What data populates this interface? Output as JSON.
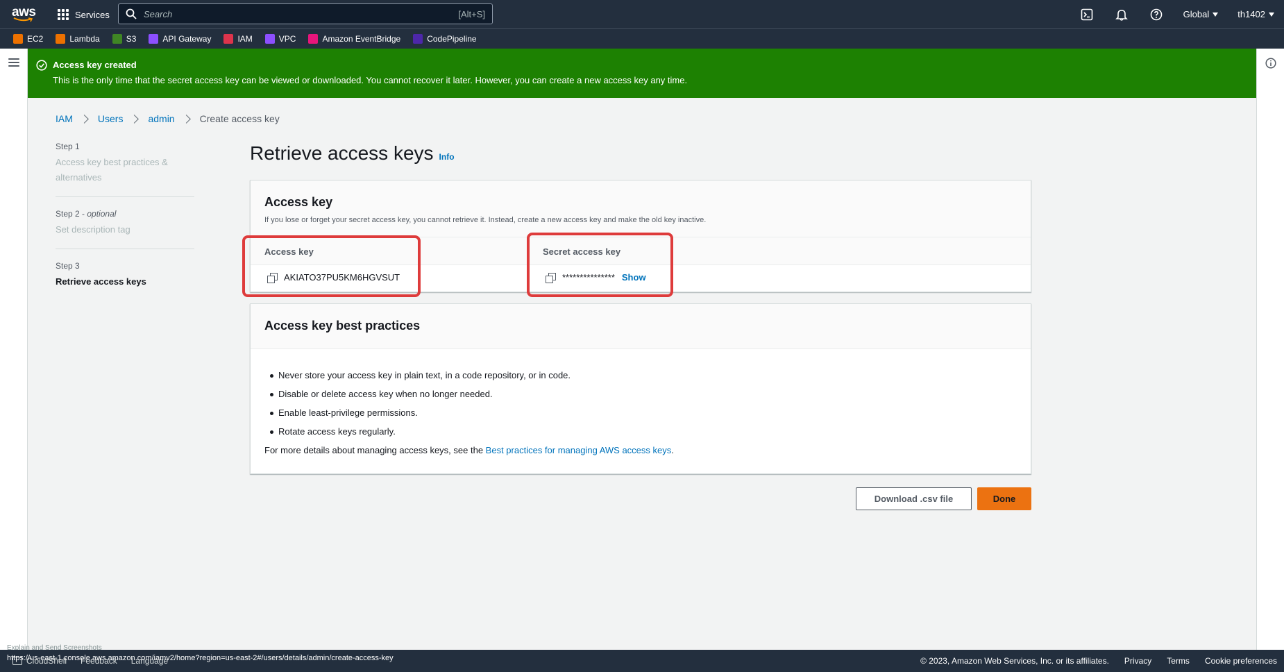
{
  "nav": {
    "logo": "aws",
    "services": "Services",
    "search_placeholder": "Search",
    "search_shortcut": "[Alt+S]",
    "region": "Global",
    "account": "th1402"
  },
  "favorites": [
    {
      "label": "EC2",
      "color": "#ed7100",
      "icon": "ec2-icon"
    },
    {
      "label": "Lambda",
      "color": "#ed7100",
      "icon": "lambda-icon"
    },
    {
      "label": "S3",
      "color": "#3f8624",
      "icon": "s3-icon"
    },
    {
      "label": "API Gateway",
      "color": "#8c4fff",
      "icon": "api-gateway-icon"
    },
    {
      "label": "IAM",
      "color": "#dd344c",
      "icon": "iam-icon"
    },
    {
      "label": "VPC",
      "color": "#8c4fff",
      "icon": "vpc-icon"
    },
    {
      "label": "Amazon EventBridge",
      "color": "#e7157b",
      "icon": "eventbridge-icon"
    },
    {
      "label": "CodePipeline",
      "color": "#4d27aa",
      "icon": "codepipeline-icon"
    }
  ],
  "flash": {
    "title": "Access key created",
    "message": "This is the only time that the secret access key can be viewed or downloaded. You cannot recover it later. However, you can create a new access key any time.",
    "color": "#1d8102"
  },
  "breadcrumb": [
    "IAM",
    "Users",
    "admin",
    "Create access key"
  ],
  "steps": [
    {
      "num": "Step 1",
      "optional": "",
      "label": "Access key best practices & alternatives"
    },
    {
      "num": "Step 2",
      "optional": "optional",
      "label": "Set description tag"
    },
    {
      "num": "Step 3",
      "optional": "",
      "label": "Retrieve access keys"
    }
  ],
  "page": {
    "title": "Retrieve access keys",
    "info": "Info"
  },
  "access_key_panel": {
    "title": "Access key",
    "description": "If you lose or forget your secret access key, you cannot retrieve it. Instead, create a new access key and make the old key inactive.",
    "access_key_label": "Access key",
    "access_key_value": "AKIATO37PU5KM6HGVSUT",
    "secret_label": "Secret access key",
    "secret_value": "***************",
    "show": "Show"
  },
  "best_practices": {
    "title": "Access key best practices",
    "items": [
      "Never store your access key in plain text, in a code repository, or in code.",
      "Disable or delete access key when no longer needed.",
      "Enable least-privilege permissions.",
      "Rotate access keys regularly."
    ],
    "more_prefix": "For more details about managing access keys, see the ",
    "more_link": "Best practices for managing AWS access keys",
    "more_suffix": "."
  },
  "buttons": {
    "download": "Download .csv file",
    "done": "Done"
  },
  "bottom": {
    "screenshot_note": "Explain and Send Screenshots",
    "cloudshell": "CloudShell",
    "feedback": "Feedback",
    "language": "Language",
    "url": "https://us-east-1.console.aws.amazon.com/iamv2/home?region=us-east-2#/users/details/admin/create-access-key",
    "copyright": "© 2023, Amazon Web Services, Inc. or its affiliates.",
    "privacy": "Privacy",
    "terms": "Terms",
    "cookies": "Cookie preferences"
  }
}
